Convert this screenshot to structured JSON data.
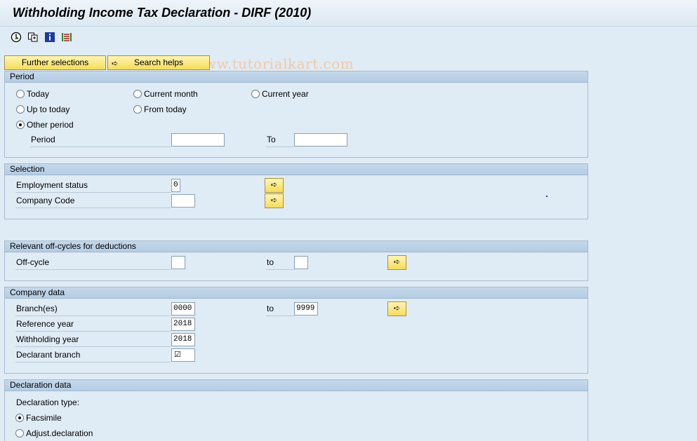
{
  "window": {
    "title": "Withholding Income Tax Declaration - DIRF (2010)"
  },
  "toolbar": {
    "icons": [
      "execute-icon",
      "variants-icon",
      "info-icon",
      "dynamic-selections-icon"
    ],
    "watermark": "© www.tutorialkart.com"
  },
  "top_buttons": {
    "further_selections": "Further selections",
    "search_helps": "Search helps"
  },
  "period": {
    "header": "Period",
    "radios": {
      "today": "Today",
      "current_month": "Current month",
      "current_year": "Current year",
      "up_to_today": "Up to today",
      "from_today": "From today",
      "other_period": "Other period"
    },
    "selected": "other_period",
    "period_label": "Period",
    "period_from": "",
    "to_label": "To",
    "period_to": ""
  },
  "selection": {
    "header": "Selection",
    "employment_status_label": "Employment status",
    "employment_status_value": "0",
    "company_code_label": "Company Code",
    "company_code_value": ""
  },
  "offcycles": {
    "header": "Relevant off-cycles for deductions",
    "offcycle_label": "Off-cycle",
    "offcycle_from": "",
    "to_label": "to",
    "offcycle_to": ""
  },
  "company_data": {
    "header": "Company data",
    "branches_label": "Branch(es)",
    "branches_from": "0000",
    "to_label": "to",
    "branches_to": "9999",
    "reference_year_label": "Reference year",
    "reference_year_value": "2018",
    "withholding_year_label": "Withholding year",
    "withholding_year_value": "2018",
    "declarant_branch_label": "Declarant branch",
    "declarant_branch_checked": true
  },
  "declaration_data": {
    "header": "Declaration data",
    "declaration_type_label": "Declaration type:",
    "facsimile_label": "Facsimile",
    "adjust_label": "Adjust.declaration",
    "selected": "facsimile"
  }
}
